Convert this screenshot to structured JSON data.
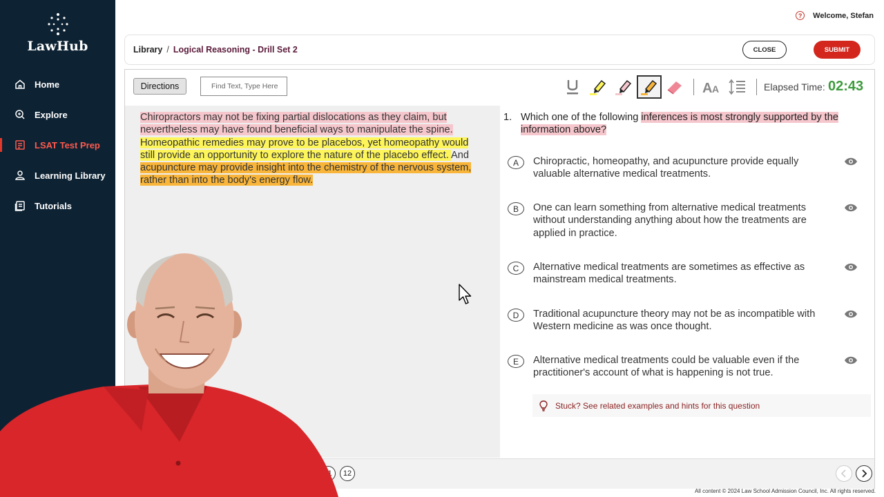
{
  "brand": {
    "name": "LawHub"
  },
  "sidebar": {
    "items": [
      {
        "label": "Home",
        "icon": "home-icon"
      },
      {
        "label": "Explore",
        "icon": "compass-icon"
      },
      {
        "label": "LSAT Test Prep",
        "icon": "test-prep-icon",
        "active": true
      },
      {
        "label": "Learning Library",
        "icon": "library-icon"
      },
      {
        "label": "Tutorials",
        "icon": "tutorials-icon"
      }
    ]
  },
  "topbar": {
    "welcome": "Welcome, Stefan"
  },
  "header": {
    "breadcrumb": {
      "root": "Library",
      "separator": "/",
      "current": "Logical Reasoning - Drill Set 2"
    },
    "close_label": "CLOSE",
    "submit_label": "SUBMIT"
  },
  "toolbar": {
    "directions_label": "Directions",
    "find_placeholder": "Find Text, Type Here",
    "elapsed_label": "Elapsed Time:",
    "elapsed_value": "02:43"
  },
  "passage": {
    "seg1": "Chiropractors may not be fixing partial dislocations as they claim, but nevertheless may have found beneficial ways to manipulate the spine.",
    "seg2": " Homeopathic remedies may prove to be placebos, yet homeopathy would still provide an opportunity to explore the nature of the placebo effect. ",
    "seg3": " And ",
    "seg4": "acupuncture may provide insight into the chemistry of the nervous system, rather than into the body's energy flow."
  },
  "question": {
    "number": "1.",
    "stem_plain": "Which one of the following ",
    "stem_highlight": "inferences is most strongly supported by the information above?",
    "choices": [
      {
        "letter": "A",
        "text": "Chiropractic, homeopathy, and acupuncture provide equally valuable alternative medical treatments."
      },
      {
        "letter": "B",
        "text": "One can learn something from alternative medical treatments without understanding anything about how the treatments are applied in practice."
      },
      {
        "letter": "C",
        "text": "Alternative medical treatments are sometimes as effective as mainstream medical treatments."
      },
      {
        "letter": "D",
        "text": "Traditional acupuncture theory may not be as incompatible with Western medicine as was once thought."
      },
      {
        "letter": "E",
        "text": "Alternative medical treatments could be valuable even if the practitioner's account of what is happening is not true."
      }
    ],
    "hint": "Stuck? See related examples and hints for this question"
  },
  "bottom_nav": {
    "q11": "11",
    "q12": "12"
  },
  "footer": "All content © 2024 Law School Admission Council, Inc. All rights reserved.",
  "colors": {
    "sidebar_bg": "#0d2233",
    "accent_red": "#d3261d",
    "timer_green": "#3d9b3d",
    "highlight_pink": "#f5c6cc",
    "highlight_yellow": "#fdf55a",
    "highlight_orange": "#f8b53a"
  }
}
